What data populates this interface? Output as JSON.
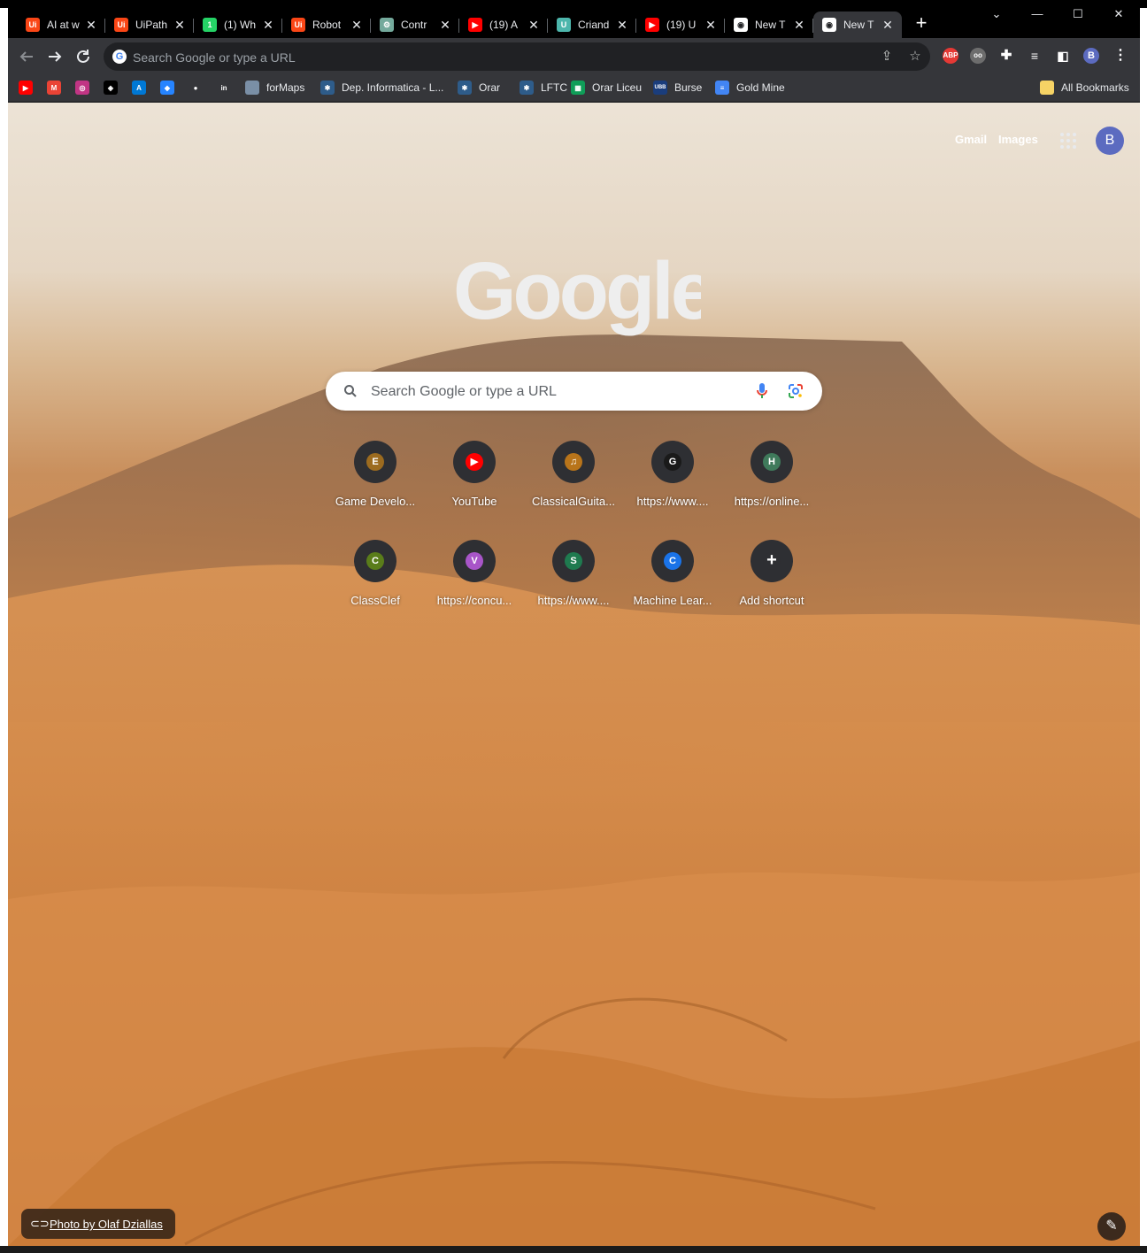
{
  "tabs": [
    {
      "title": "AI at w",
      "favicon": "uipath-icon",
      "color": "#fa4616",
      "glyph": "Ui"
    },
    {
      "title": "UiPath",
      "favicon": "uipath-icon",
      "color": "#fa4616",
      "glyph": "Ui"
    },
    {
      "title": "(1) Wh",
      "favicon": "whatsapp-icon",
      "color": "#25d366",
      "glyph": "1"
    },
    {
      "title": "Robot",
      "favicon": "uipath-icon",
      "color": "#fa4616",
      "glyph": "Ui"
    },
    {
      "title": "Contr",
      "favicon": "chatgpt-icon",
      "color": "#74aa9c",
      "glyph": "⚙"
    },
    {
      "title": "(19) A",
      "favicon": "youtube-icon",
      "color": "#ff0000",
      "glyph": "▶"
    },
    {
      "title": "Criand",
      "favicon": "shield-icon",
      "color": "#4db6ac",
      "glyph": "U"
    },
    {
      "title": "(19) U",
      "favicon": "youtube-icon",
      "color": "#ff0000",
      "glyph": "▶"
    },
    {
      "title": "New T",
      "favicon": "chrome-icon",
      "color": "#ffffff",
      "glyph": "◉"
    },
    {
      "title": "New T",
      "favicon": "chrome-icon",
      "color": "#ffffff",
      "glyph": "◉",
      "active": true
    }
  ],
  "new_tab_glyph": "+",
  "window_controls": {
    "dropdown": "⌄",
    "minimize": "—",
    "maximize": "☐",
    "close": "✕"
  },
  "omnibox": {
    "placeholder": "Search Google or type a URL"
  },
  "toolbar_avatar": "B",
  "bookmarks": [
    {
      "label": "",
      "icon": "youtube-icon",
      "color": "#ff0000",
      "glyph": "▶"
    },
    {
      "label": "",
      "icon": "gmail-icon",
      "color": "#ea4335",
      "glyph": "M"
    },
    {
      "label": "",
      "icon": "instagram-icon",
      "color": "#c13584",
      "glyph": "◎"
    },
    {
      "label": "",
      "icon": "unity-icon",
      "color": "#000000",
      "glyph": "◈"
    },
    {
      "label": "",
      "icon": "azure-icon",
      "color": "#0078d4",
      "glyph": "A"
    },
    {
      "label": "",
      "icon": "bitbucket-icon",
      "color": "#2684ff",
      "glyph": "◆"
    },
    {
      "label": "",
      "icon": "github-icon",
      "color": "#35363a",
      "glyph": "●"
    },
    {
      "label": "",
      "icon": "in-icon",
      "color": "#35363a",
      "glyph": "in"
    },
    {
      "label": "forMaps",
      "icon": "image-icon",
      "color": "#7a8fa6",
      "glyph": ""
    },
    {
      "label": "Dep. Informatica - L...",
      "icon": "ubb-icon",
      "color": "#2e5c8a",
      "glyph": "✱"
    },
    {
      "label": "Orar",
      "icon": "ubb-icon",
      "color": "#2e5c8a",
      "glyph": "✱"
    },
    {
      "label": "LFTC",
      "icon": "ubb-icon",
      "color": "#2e5c8a",
      "glyph": "✱"
    },
    {
      "label": "Orar Liceu",
      "icon": "sheets-icon",
      "color": "#0f9d58",
      "glyph": "▦"
    },
    {
      "label": "Burse",
      "icon": "ubb-logo-icon",
      "color": "#1a3d7c",
      "glyph": "UBB"
    },
    {
      "label": "Gold Mine",
      "icon": "docs-icon",
      "color": "#4285f4",
      "glyph": "≡"
    }
  ],
  "all_bookmarks": "All Bookmarks",
  "header_links": {
    "gmail": "Gmail",
    "images": "Images"
  },
  "account_avatar": "B",
  "search": {
    "placeholder": "Search Google or type a URL"
  },
  "shortcuts": [
    {
      "label": "Game Develo...",
      "glyph": "E",
      "color": "#9c6b1f"
    },
    {
      "label": "YouTube",
      "glyph": "▶",
      "color": "#ff0000"
    },
    {
      "label": "ClassicalGuita...",
      "glyph": "♫",
      "color": "#b8741a"
    },
    {
      "label": "https://www....",
      "glyph": "G",
      "color": "#1a1a1a"
    },
    {
      "label": "https://online...",
      "glyph": "H",
      "color": "#3f7a5b"
    },
    {
      "label": "ClassClef",
      "glyph": "C",
      "color": "#5a7d1a"
    },
    {
      "label": "https://concu...",
      "glyph": "V",
      "color": "#a855c8"
    },
    {
      "label": "https://www....",
      "glyph": "S",
      "color": "#1f7a4f"
    },
    {
      "label": "Machine Lear...",
      "glyph": "C",
      "color": "#1a73e8"
    },
    {
      "label": "Add shortcut",
      "glyph": "+",
      "color": "#2e2f33"
    }
  ],
  "photo_credit": "Photo by Olaf Dziallas",
  "customize_icon": "pencil-icon"
}
